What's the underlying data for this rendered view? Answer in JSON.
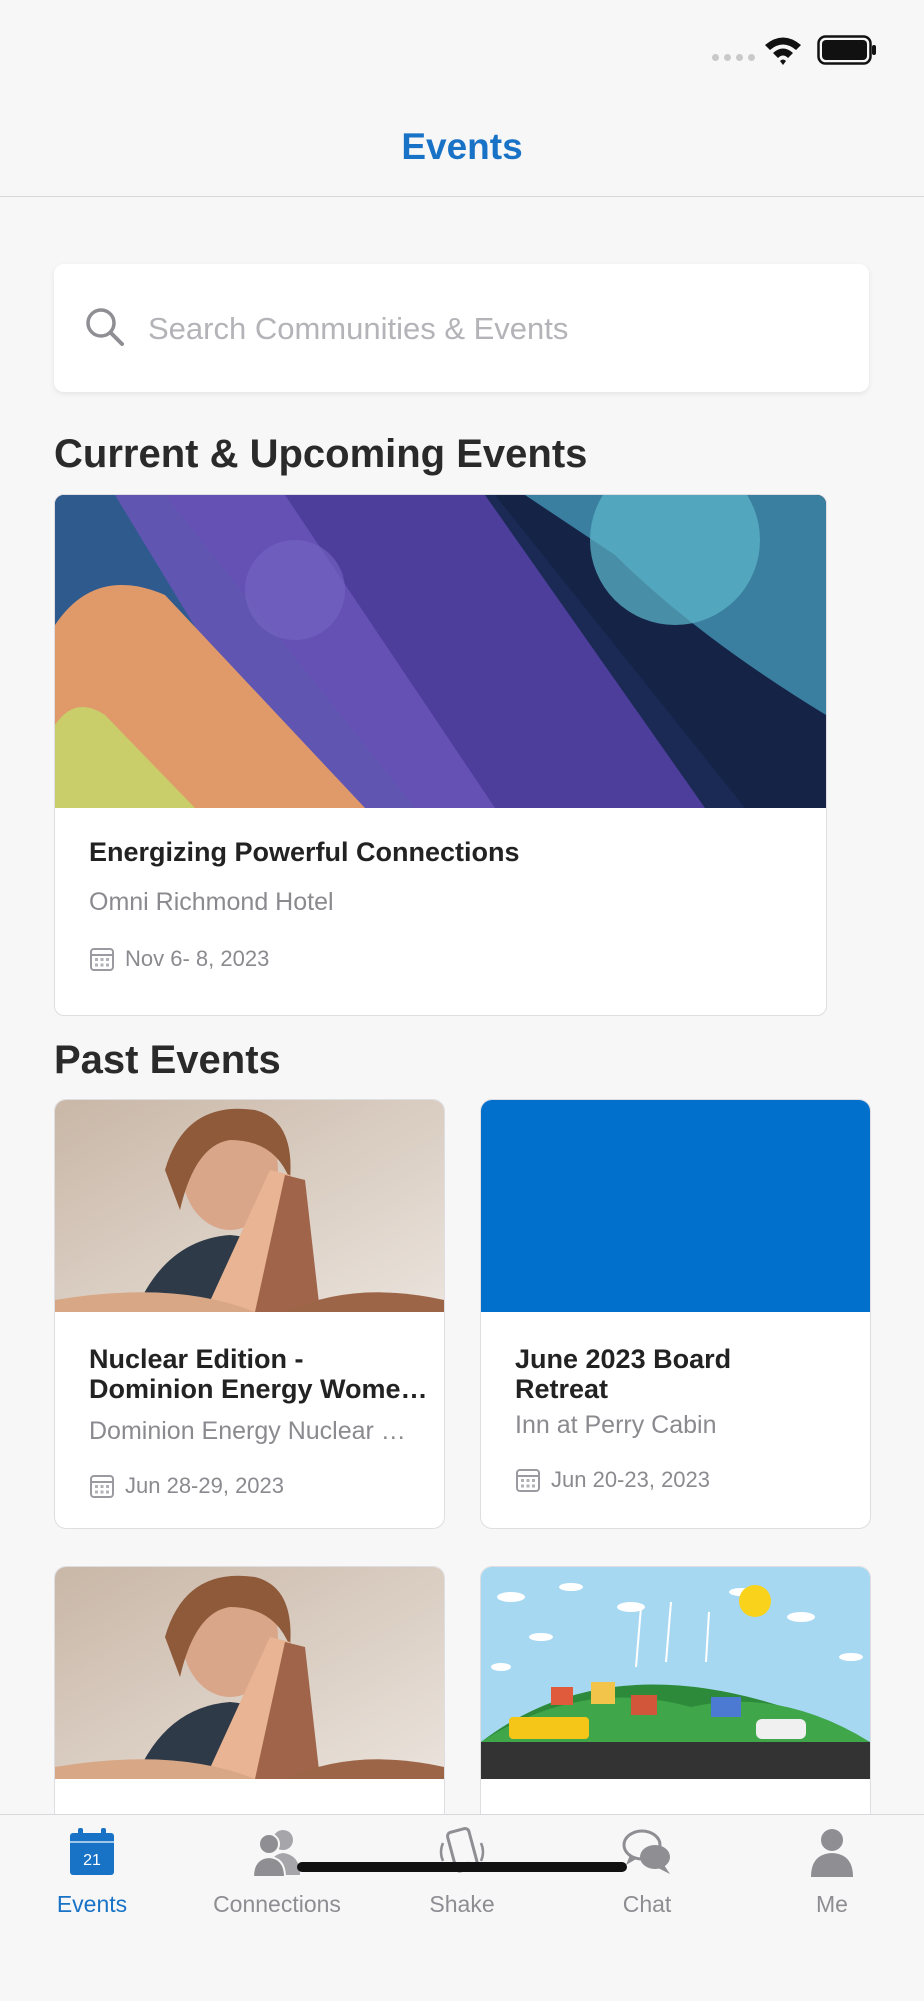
{
  "header": {
    "title": "Events"
  },
  "search": {
    "placeholder": "Search Communities & Events"
  },
  "sections": {
    "current": "Current & Upcoming Events",
    "past": "Past Events"
  },
  "featured_event": {
    "title": "Energizing Powerful Connections",
    "venue": "Omni Richmond Hotel",
    "date": "Nov  6- 8, 2023"
  },
  "past_events": [
    {
      "title_line1": "Nuclear Edition -",
      "title_line2": "Dominion Energy Wome…",
      "venue": "Dominion Energy Nuclear W…",
      "date": "Jun 28-29, 2023",
      "image": "hands-photo"
    },
    {
      "title_line1": "June 2023 Board",
      "title_line2": "Retreat",
      "venue": "Inn at Perry Cabin",
      "date": "Jun 20-23, 2023",
      "image": "blue-solid"
    },
    {
      "image": "hands-photo"
    },
    {
      "image": "green-town-illustration"
    }
  ],
  "tabs": [
    {
      "label": "Events",
      "icon": "calendar-icon",
      "active": true,
      "badge": "21"
    },
    {
      "label": "Connections",
      "icon": "people-icon",
      "active": false
    },
    {
      "label": "Shake",
      "icon": "phone-shake-icon",
      "active": false
    },
    {
      "label": "Chat",
      "icon": "chat-bubbles-icon",
      "active": false
    },
    {
      "label": "Me",
      "icon": "person-icon",
      "active": false
    }
  ],
  "colors": {
    "accent": "#1872c6",
    "blue_card": "#0070cc",
    "secondary_text": "#8a8a8f"
  }
}
